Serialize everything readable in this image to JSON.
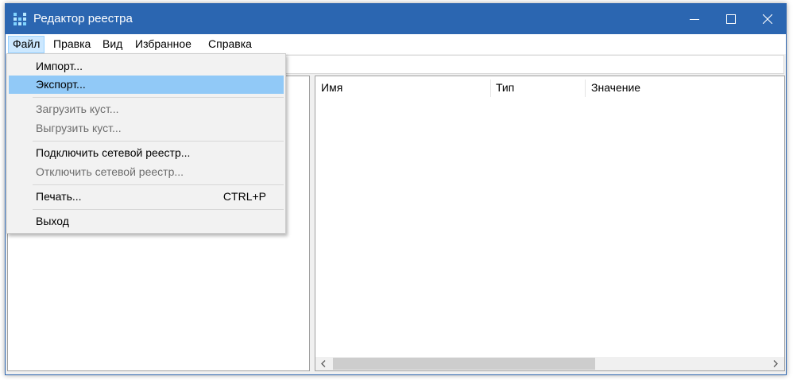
{
  "window": {
    "title": "Редактор реестра",
    "accent_color": "#2b66b1",
    "icons": [
      "regedit-app-icon",
      "minimize-icon",
      "maximize-icon",
      "close-icon"
    ]
  },
  "menubar": {
    "items": [
      "Файл",
      "Правка",
      "Вид",
      "Избранное",
      "Справка"
    ],
    "active": "Файл"
  },
  "file_menu": {
    "items": [
      {
        "label": "Импорт...",
        "enabled": true
      },
      {
        "label": "Экспорт...",
        "enabled": true,
        "highlighted": true
      },
      {
        "label": "Загрузить куст...",
        "enabled": false
      },
      {
        "label": "Выгрузить куст...",
        "enabled": false
      },
      {
        "label": "Подключить сетевой реестр...",
        "enabled": true
      },
      {
        "label": "Отключить сетевой реестр...",
        "enabled": false
      },
      {
        "label": "Печать...",
        "enabled": true,
        "shortcut": "CTRL+P"
      },
      {
        "label": "Выход",
        "enabled": true
      }
    ]
  },
  "list_view": {
    "columns": [
      "Имя",
      "Тип",
      "Значение"
    ]
  }
}
